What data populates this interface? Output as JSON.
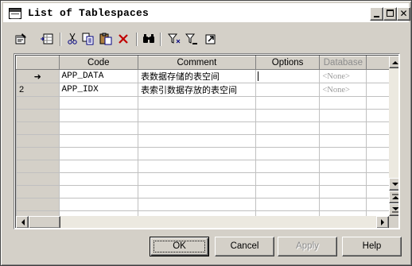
{
  "window": {
    "title": "List of Tablespaces"
  },
  "toolbar": {
    "items": [
      "properties-icon",
      "add-row-icon",
      "cut-icon",
      "copy-icon",
      "paste-icon",
      "delete-icon",
      "find-icon",
      "filter-icon",
      "filter-clear-icon",
      "export-icon"
    ]
  },
  "grid": {
    "columns": [
      "Code",
      "Comment",
      "Options",
      "Database"
    ],
    "rows": [
      {
        "marker": "➜",
        "code": "APP_DATA",
        "comment": "表数据存储的表空间",
        "options": "",
        "database": "<None>"
      },
      {
        "marker": "2",
        "code": "APP_IDX",
        "comment": "表索引数据存放的表空间",
        "options": "",
        "database": "<None>"
      }
    ]
  },
  "buttons": {
    "ok": "OK",
    "cancel": "Cancel",
    "apply": "Apply",
    "help": "Help"
  },
  "colors": {
    "disabled_text": "#8d8d8d",
    "face": "#d4d0c8"
  }
}
